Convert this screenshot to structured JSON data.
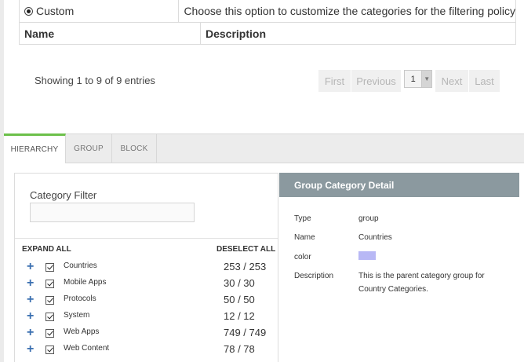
{
  "policy_table": {
    "custom_label": "Custom",
    "custom_description": "Choose this option to customize the categories for the filtering policy",
    "col_name": "Name",
    "col_description": "Description"
  },
  "showing": "Showing 1 to 9 of 9 entries",
  "pagination": {
    "first": "First",
    "previous": "Previous",
    "page": "1",
    "next": "Next",
    "last": "Last"
  },
  "tabs": [
    "HIERARCHY",
    "GROUP",
    "BLOCK"
  ],
  "category_filter": {
    "label": "Category Filter",
    "value": "",
    "expand_all": "EXPAND ALL",
    "deselect_all": "DESELECT ALL"
  },
  "tree": [
    {
      "name": "Countries",
      "count": "253 / 253"
    },
    {
      "name": "Mobile Apps",
      "count": "30 / 30"
    },
    {
      "name": "Protocols",
      "count": "50 / 50"
    },
    {
      "name": "System",
      "count": "12 / 12"
    },
    {
      "name": "Web Apps",
      "count": "749 / 749"
    },
    {
      "name": "Web Content",
      "count": "78 / 78"
    }
  ],
  "detail": {
    "title": "Group Category Detail",
    "type_label": "Type",
    "type_value": "group",
    "name_label": "Name",
    "name_value": "Countries",
    "color_label": "color",
    "color_value": "#b8b8f5",
    "description_label": "Description",
    "description_line1": "This is the parent category group for",
    "description_line2": "Country Categories."
  },
  "colors": {
    "active_tab_accent": "#6cc04a",
    "detail_header": "#8b999f",
    "tree_plus": "#3a6fb0"
  }
}
